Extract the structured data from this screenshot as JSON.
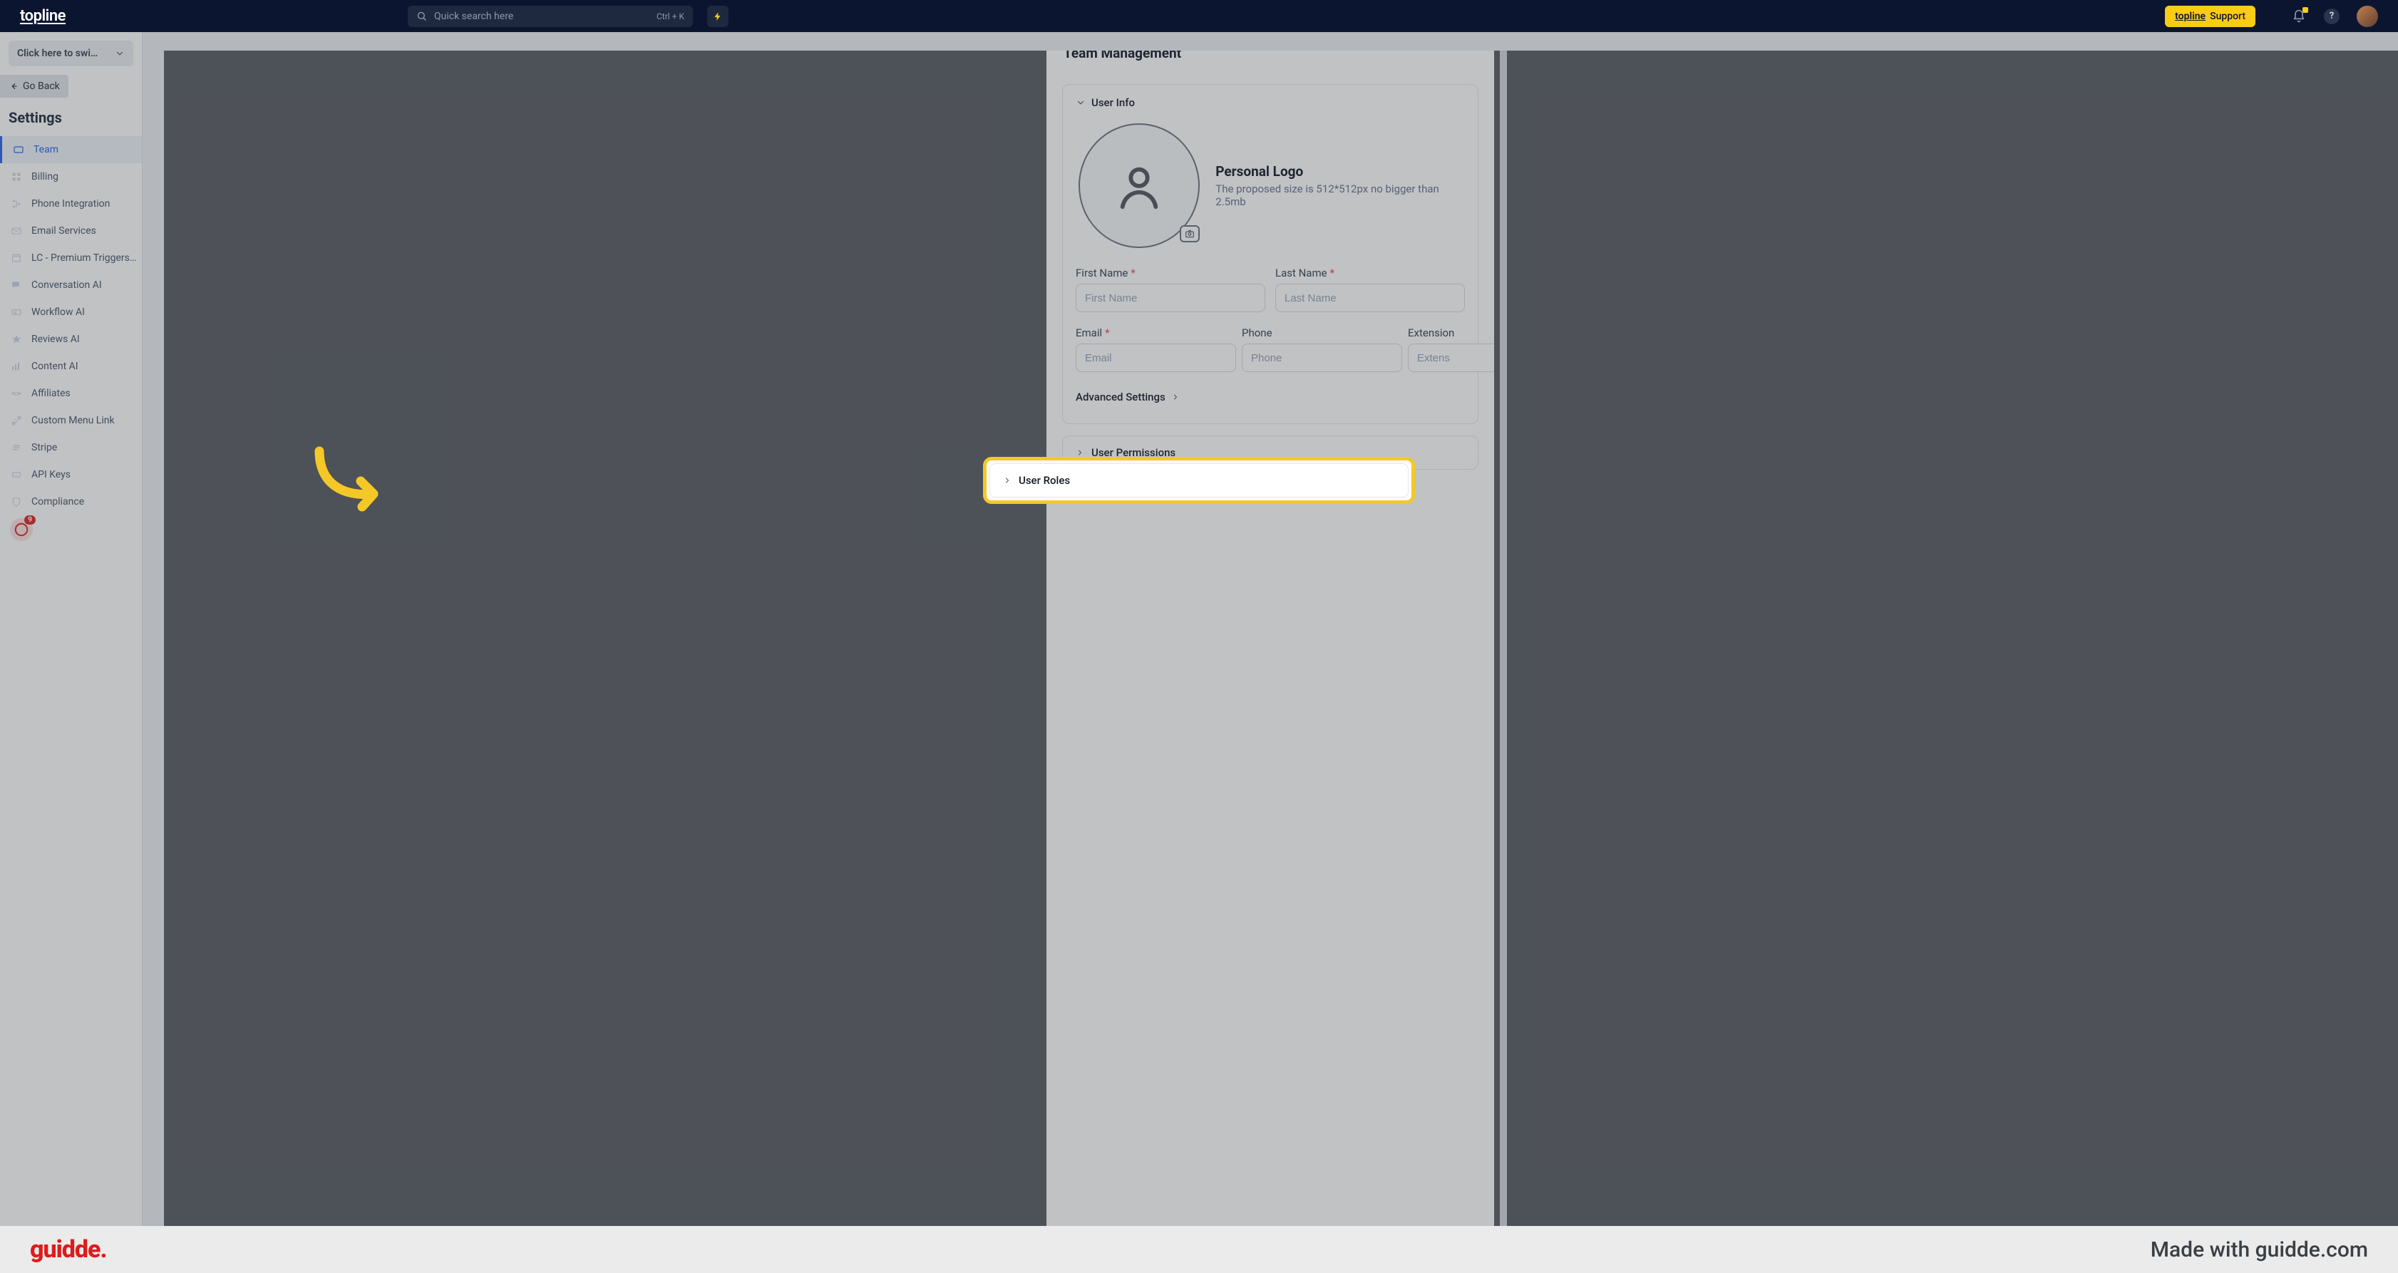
{
  "header": {
    "brand": "topline",
    "search_placeholder": "Quick search here",
    "search_shortcut": "Ctrl + K",
    "support_brand": "topline",
    "support_label": "Support",
    "help_label": "?"
  },
  "sidebar": {
    "switch_label": "Click here to swi…",
    "go_back": "Go Back",
    "heading": "Settings",
    "items": [
      {
        "label": "Team",
        "icon": "team"
      },
      {
        "label": "Billing",
        "icon": "billing"
      },
      {
        "label": "Phone Integration",
        "icon": "phone"
      },
      {
        "label": "Email Services",
        "icon": "mail"
      },
      {
        "label": "LC - Premium Triggers…",
        "icon": "store"
      },
      {
        "label": "Conversation AI",
        "icon": "chat"
      },
      {
        "label": "Workflow AI",
        "icon": "flow"
      },
      {
        "label": "Reviews AI",
        "icon": "star"
      },
      {
        "label": "Content AI",
        "icon": "content"
      },
      {
        "label": "Affiliates",
        "icon": "aff"
      },
      {
        "label": "Custom Menu Link",
        "icon": "link"
      },
      {
        "label": "Stripe",
        "icon": "stripe"
      },
      {
        "label": "API Keys",
        "icon": "api"
      },
      {
        "label": "Compliance",
        "icon": "shield"
      }
    ],
    "badge_count": "9"
  },
  "modal": {
    "header": "Team Management",
    "section_user_info": "User Info",
    "logo_title": "Personal Logo",
    "logo_sub": "The proposed size is 512*512px no bigger than 2.5mb",
    "first_name_label": "First Name",
    "first_name_placeholder": "First Name",
    "last_name_label": "Last Name",
    "last_name_placeholder": "Last Name",
    "email_label": "Email",
    "email_placeholder": "Email",
    "phone_label": "Phone",
    "phone_placeholder": "Phone",
    "ext_label": "Extension",
    "ext_placeholder": "Extens",
    "advanced": "Advanced Settings",
    "section_permissions": "User Permissions",
    "section_roles": "User Roles"
  },
  "footer": {
    "logo": "guidde.",
    "tagline": "Made with guidde.com"
  }
}
